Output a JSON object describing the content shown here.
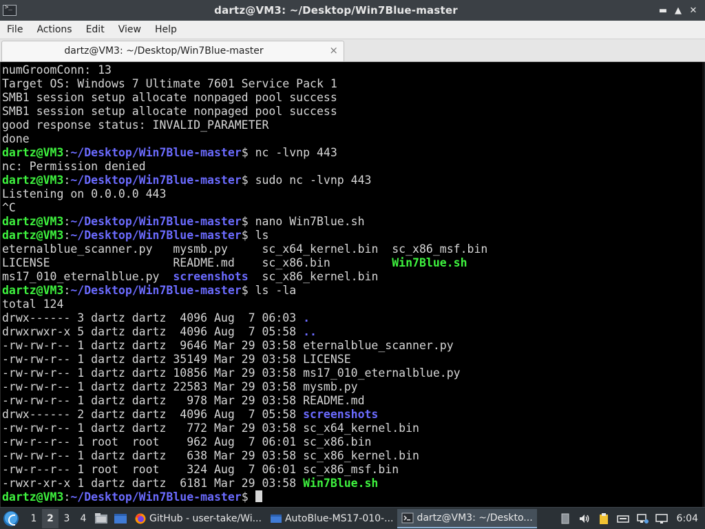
{
  "window": {
    "title": "dartz@VM3: ~/Desktop/Win7Blue-master",
    "controls": [
      "minimize-icon",
      "restore-icon",
      "close-icon"
    ]
  },
  "menu": [
    "File",
    "Actions",
    "Edit",
    "View",
    "Help"
  ],
  "tab": {
    "label": "dartz@VM3: ~/Desktop/Win7Blue-master",
    "close": "×"
  },
  "prompt": {
    "user_host": "dartz@VM3",
    "sep": ":",
    "path": "~/Desktop/Win7Blue-master",
    "dollar": "$ "
  },
  "terminal": {
    "lines": [
      {
        "type": "out",
        "text": "numGroomConn: 13"
      },
      {
        "type": "out",
        "text": "Target OS: Windows 7 Ultimate 7601 Service Pack 1"
      },
      {
        "type": "out",
        "text": "SMB1 session setup allocate nonpaged pool success"
      },
      {
        "type": "out",
        "text": "SMB1 session setup allocate nonpaged pool success"
      },
      {
        "type": "out",
        "text": "good response status: INVALID_PARAMETER"
      },
      {
        "type": "out",
        "text": "done"
      },
      {
        "type": "prompt",
        "cmd": "nc -lvnp 443"
      },
      {
        "type": "out",
        "text": "nc: Permission denied"
      },
      {
        "type": "prompt",
        "cmd": "sudo nc -lvnp 443"
      },
      {
        "type": "out",
        "text": "Listening on 0.0.0.0 443"
      },
      {
        "type": "out",
        "text": "^C"
      },
      {
        "type": "prompt",
        "cmd": "nano Win7Blue.sh"
      },
      {
        "type": "prompt",
        "cmd": "ls"
      },
      {
        "type": "cols",
        "segs": [
          [
            "eternalblue_scanner.py   ",
            "w"
          ],
          [
            "mysmb.py     ",
            "w"
          ],
          [
            "sc_x64_kernel.bin  ",
            "w"
          ],
          [
            "sc_x86_msf.bin",
            "w"
          ]
        ]
      },
      {
        "type": "cols",
        "segs": [
          [
            "LICENSE                  ",
            "w"
          ],
          [
            "README.md    ",
            "w"
          ],
          [
            "sc_x86.bin         ",
            "w"
          ],
          [
            "Win7Blue.sh",
            "g"
          ]
        ]
      },
      {
        "type": "cols",
        "segs": [
          [
            "ms17_010_eternalblue.py  ",
            "w"
          ],
          [
            "screenshots",
            "b"
          ],
          [
            "  ",
            "w"
          ],
          [
            "sc_x86_kernel.bin",
            "w"
          ]
        ]
      },
      {
        "type": "prompt",
        "cmd": "ls -la"
      },
      {
        "type": "out",
        "text": "total 124"
      },
      {
        "type": "ll",
        "meta": "drwx------ 3 dartz dartz  4096 Aug  7 06:03 ",
        "name": ".",
        "cls": "b"
      },
      {
        "type": "ll",
        "meta": "drwxrwxr-x 5 dartz dartz  4096 Aug  7 05:58 ",
        "name": "..",
        "cls": "b"
      },
      {
        "type": "ll",
        "meta": "-rw-rw-r-- 1 dartz dartz  9646 Mar 29 03:58 ",
        "name": "eternalblue_scanner.py",
        "cls": "w"
      },
      {
        "type": "ll",
        "meta": "-rw-rw-r-- 1 dartz dartz 35149 Mar 29 03:58 ",
        "name": "LICENSE",
        "cls": "w"
      },
      {
        "type": "ll",
        "meta": "-rw-rw-r-- 1 dartz dartz 10856 Mar 29 03:58 ",
        "name": "ms17_010_eternalblue.py",
        "cls": "w"
      },
      {
        "type": "ll",
        "meta": "-rw-rw-r-- 1 dartz dartz 22583 Mar 29 03:58 ",
        "name": "mysmb.py",
        "cls": "w"
      },
      {
        "type": "ll",
        "meta": "-rw-rw-r-- 1 dartz dartz   978 Mar 29 03:58 ",
        "name": "README.md",
        "cls": "w"
      },
      {
        "type": "ll",
        "meta": "drwx------ 2 dartz dartz  4096 Aug  7 05:58 ",
        "name": "screenshots",
        "cls": "b"
      },
      {
        "type": "ll",
        "meta": "-rw-rw-r-- 1 dartz dartz   772 Mar 29 03:58 ",
        "name": "sc_x64_kernel.bin",
        "cls": "w"
      },
      {
        "type": "ll",
        "meta": "-rw-r--r-- 1 root  root    962 Aug  7 06:01 ",
        "name": "sc_x86.bin",
        "cls": "w"
      },
      {
        "type": "ll",
        "meta": "-rw-rw-r-- 1 dartz dartz   638 Mar 29 03:58 ",
        "name": "sc_x86_kernel.bin",
        "cls": "w"
      },
      {
        "type": "ll",
        "meta": "-rw-r--r-- 1 root  root    324 Aug  7 06:01 ",
        "name": "sc_x86_msf.bin",
        "cls": "w"
      },
      {
        "type": "ll",
        "meta": "-rwxr-xr-x 1 dartz dartz  6181 Mar 29 03:58 ",
        "name": "Win7Blue.sh",
        "cls": "g"
      },
      {
        "type": "prompt",
        "cmd": "",
        "cursor": true
      }
    ]
  },
  "taskbar": {
    "workspaces": [
      "1",
      "2",
      "3",
      "4"
    ],
    "active_workspace": 1,
    "tasks": [
      {
        "label": "GitHub - user-take/Wi...",
        "icon": "firefox-icon",
        "active": false
      },
      {
        "label": "AutoBlue-MS17-010-...",
        "icon": "window-icon",
        "active": false
      },
      {
        "label": "dartz@VM3: ~/Deskto...",
        "icon": "terminal-icon",
        "active": true
      }
    ],
    "clock": "6:04"
  },
  "colors": {
    "prompt_green": "#3ef23e",
    "dir_blue": "#6b6bff",
    "text": "#d7d7d7",
    "background": "#000000",
    "titlebar": "#3b4045",
    "taskbar": "#2b3136"
  }
}
